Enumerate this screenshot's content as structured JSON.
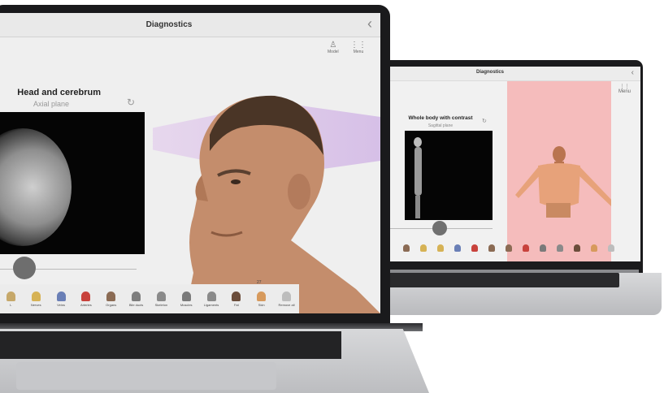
{
  "app": {
    "title": "Diagnostics",
    "menu_label": "Menu",
    "model_label": "Model"
  },
  "front": {
    "panel_title": "Head and cerebrum",
    "panel_subtitle": "Axial plane",
    "slider_value": 0.22,
    "tiny_label": "27",
    "toolbar": [
      {
        "label": "L",
        "color": "#c6a86a"
      },
      {
        "label": "Nerves",
        "color": "#d6b255"
      },
      {
        "label": "Veins",
        "color": "#6a7fb6"
      },
      {
        "label": "Arteries",
        "color": "#c8423c"
      },
      {
        "label": "Organs",
        "color": "#8b6b54"
      },
      {
        "label": "Bile ducts",
        "color": "#7e7e7e"
      },
      {
        "label": "Skeleton",
        "color": "#8a8a8a"
      },
      {
        "label": "Muscles",
        "color": "#7a7a7a"
      },
      {
        "label": "Ligaments",
        "color": "#8a8a8a"
      },
      {
        "label": "Fat",
        "color": "#6b4d3b"
      },
      {
        "label": "Skin",
        "color": "#d79a5d"
      },
      {
        "label": "Remove all",
        "color": "#bdbdbd"
      }
    ]
  },
  "back": {
    "panel_title": "Whole body with contrast",
    "panel_subtitle": "Sagittal plane",
    "slider_value": 0.5,
    "toolbar": [
      {
        "label": "",
        "color": "#8b6b54"
      },
      {
        "label": "",
        "color": "#d6b255"
      },
      {
        "label": "",
        "color": "#d6b255"
      },
      {
        "label": "",
        "color": "#6a7fb6"
      },
      {
        "label": "",
        "color": "#c8423c"
      },
      {
        "label": "",
        "color": "#8b6b54"
      },
      {
        "label": "",
        "color": "#8b6b54"
      },
      {
        "label": "",
        "color": "#c8423c"
      },
      {
        "label": "",
        "color": "#7a7a7a"
      },
      {
        "label": "",
        "color": "#8a8a8a"
      },
      {
        "label": "",
        "color": "#6b4d3b"
      },
      {
        "label": "",
        "color": "#d79a5d"
      },
      {
        "label": "",
        "color": "#bdbdbd"
      }
    ]
  }
}
